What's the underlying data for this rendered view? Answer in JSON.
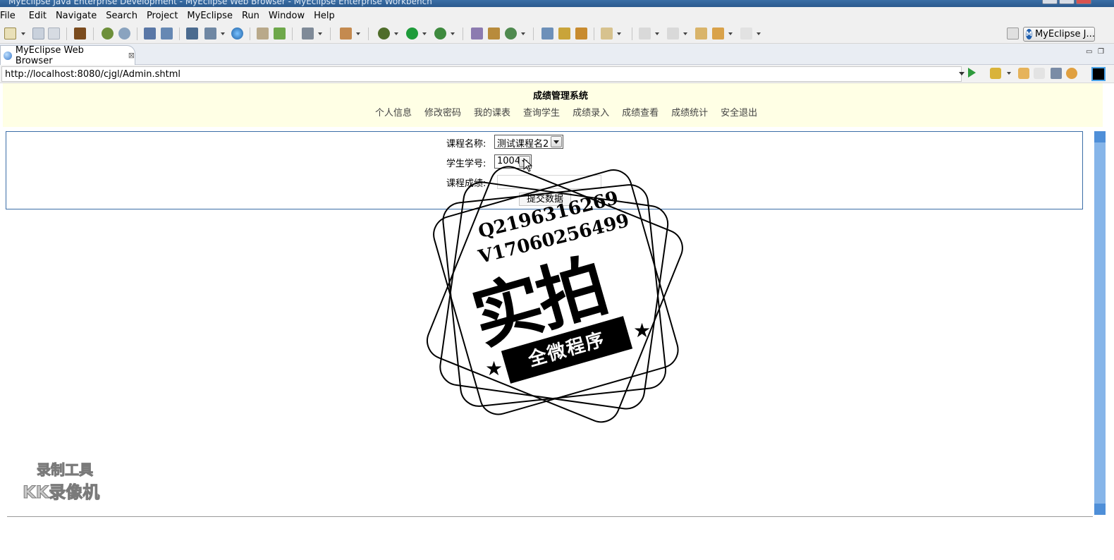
{
  "window": {
    "title": "MyEclipse Java Enterprise Development - MyEclipse Web Browser - MyEclipse Enterprise Workbench"
  },
  "menu": [
    "File",
    "Edit",
    "Navigate",
    "Search",
    "Project",
    "MyEclipse",
    "Run",
    "Window",
    "Help"
  ],
  "perspective": {
    "label": "MyEclipse J..."
  },
  "editor_tab": {
    "title": "MyEclipse Web Browser"
  },
  "browser": {
    "url": "http://localhost:8080/cjgl/Admin.shtml"
  },
  "page": {
    "title": "成绩管理系统",
    "nav": [
      "个人信息",
      "修改密码",
      "我的课表",
      "查询学生",
      "成绩录入",
      "成绩查看",
      "成绩统计",
      "安全退出"
    ],
    "form": {
      "course_label": "课程名称:",
      "course_value": "测试课程名2",
      "student_label": "学生学号:",
      "student_value": "1004",
      "score_label": "课程成绩:",
      "score_value": "",
      "submit_label": "提交数据"
    }
  },
  "stamp": {
    "line1": "Q2196316269",
    "line2": "V17060256499",
    "big": "实拍",
    "ribbon": "全微程序"
  },
  "watermark": {
    "line1": "录制工具",
    "line2": "KK录像机"
  },
  "colors": {
    "header_bg": "#ffffe5",
    "form_border": "#3b6da7",
    "scrollbar": "#86b5e9",
    "titlebar": "#3a6ea5"
  }
}
